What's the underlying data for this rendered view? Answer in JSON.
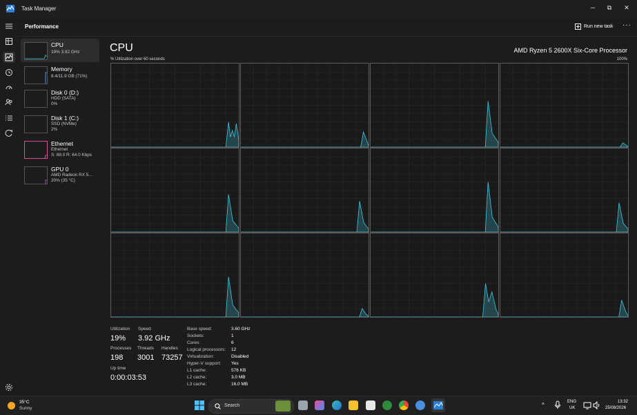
{
  "window": {
    "title": "Task Manager"
  },
  "controls": {
    "minimize": "─",
    "maximize": "⧉",
    "close": "✕"
  },
  "header": {
    "page_title": "Performance",
    "run_task_label": "Run new task",
    "more_label": "···"
  },
  "rail": {
    "items": [
      "menu-icon",
      "processes-icon",
      "performance-icon",
      "app-history-icon",
      "startup-apps-icon",
      "users-icon",
      "details-icon",
      "services-icon",
      "settings-icon"
    ]
  },
  "sidebar": {
    "items": [
      {
        "name": "CPU",
        "line1": "19% 3.92 GHz",
        "line2": "",
        "accent": "#3ec9e0"
      },
      {
        "name": "Memory",
        "line1": "8.4/11.9 GB (71%)",
        "line2": "",
        "accent": "#4d8fe8"
      },
      {
        "name": "Disk 0 (D:)",
        "line1": "HDD (SATA)",
        "line2": "0%",
        "accent": "#6dbf45"
      },
      {
        "name": "Disk 1 (C:)",
        "line1": "SSD (NVMe)",
        "line2": "2%",
        "accent": "#6dbf45"
      },
      {
        "name": "Ethernet",
        "line1": "Ethernet",
        "line2": "S: 88.0 R: 64.0 Kbps",
        "accent": "#d14e95"
      },
      {
        "name": "GPU 0",
        "line1": "AMD Radeon RX 5...",
        "line2": "20% (35 °C)",
        "accent": "#a14ed1"
      }
    ]
  },
  "main": {
    "title": "CPU",
    "processor": "AMD Ryzen 5 2600X Six-Core Processor",
    "graph_caption": "% Utilization over 60 seconds",
    "graph_max": "100%",
    "line_color": "#3ec9e0",
    "cores": [
      {
        "spikes": [
          [
            0.92,
            0.3
          ],
          [
            0.95,
            0.2
          ],
          [
            0.98,
            0.28
          ]
        ]
      },
      {
        "spikes": [
          [
            0.96,
            0.18
          ]
        ]
      },
      {
        "spikes": [
          [
            0.92,
            0.55
          ]
        ]
      },
      {
        "spikes": [
          [
            0.96,
            0.05
          ]
        ]
      },
      {
        "spikes": [
          [
            0.92,
            0.45
          ]
        ]
      },
      {
        "spikes": [
          [
            0.93,
            0.37
          ]
        ]
      },
      {
        "spikes": [
          [
            0.92,
            0.6
          ]
        ]
      },
      {
        "spikes": [
          [
            0.93,
            0.35
          ]
        ]
      },
      {
        "spikes": [
          [
            0.92,
            0.48
          ]
        ]
      },
      {
        "spikes": [
          [
            0.95,
            0.1
          ]
        ]
      },
      {
        "spikes": [
          [
            0.9,
            0.4
          ],
          [
            0.95,
            0.3
          ]
        ]
      },
      {
        "spikes": [
          [
            0.95,
            0.2
          ]
        ]
      }
    ]
  },
  "stats": {
    "utilization_label": "Utilization",
    "utilization": "19%",
    "speed_label": "Speed",
    "speed": "3.92 GHz",
    "processes_label": "Processes",
    "processes": "198",
    "threads_label": "Threads",
    "threads": "3001",
    "handles_label": "Handles",
    "handles": "73257",
    "uptime_label": "Up time",
    "uptime": "0:00:03:53"
  },
  "specs": [
    {
      "label": "Base speed:",
      "value": "3.60 GHz"
    },
    {
      "label": "Sockets:",
      "value": "1"
    },
    {
      "label": "Cores:",
      "value": "6"
    },
    {
      "label": "Logical processors:",
      "value": "12"
    },
    {
      "label": "Virtualization:",
      "value": "Disabled"
    },
    {
      "label": "Hyper-V support:",
      "value": "Yes"
    },
    {
      "label": "L1 cache:",
      "value": "576 KB"
    },
    {
      "label": "L2 cache:",
      "value": "3.0 MB"
    },
    {
      "label": "L3 cache:",
      "value": "16.0 MB"
    }
  ],
  "taskbar": {
    "weather_temp": "35°C",
    "weather_cond": "Sunny",
    "search_label": "Search",
    "lang": "ENG",
    "region": "UK",
    "time": "13:32",
    "date": "25/08/2026"
  }
}
